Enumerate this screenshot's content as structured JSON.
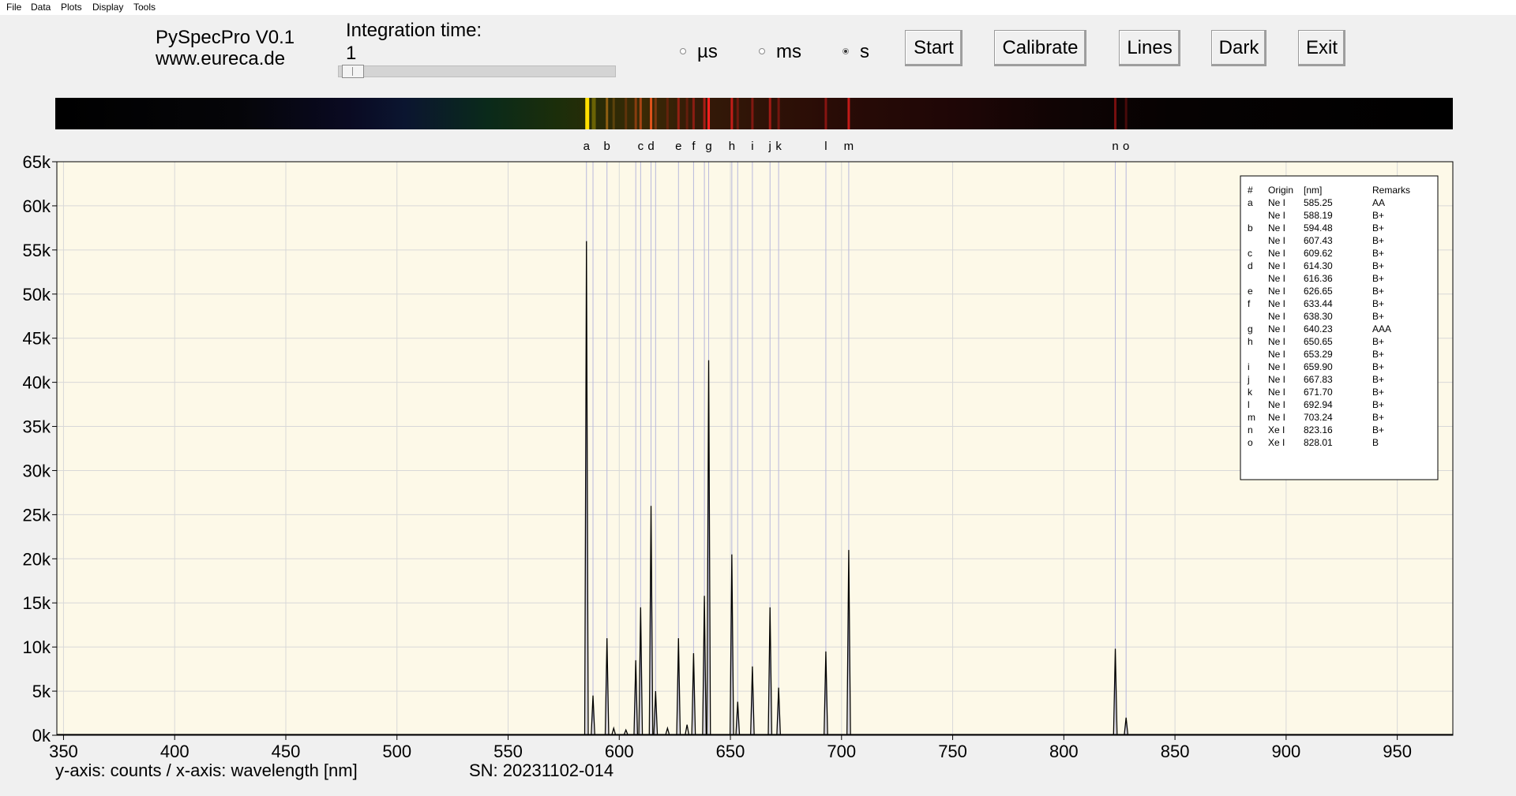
{
  "menu": [
    "File",
    "Data",
    "Plots",
    "Display",
    "Tools"
  ],
  "app": {
    "name": "PySpecPro V0.1",
    "website": "www.eureca.de"
  },
  "integration": {
    "label": "Integration time:",
    "value": "1",
    "slider_fraction": 0.01
  },
  "units": [
    {
      "label": "µs",
      "selected": false
    },
    {
      "label": "ms",
      "selected": false
    },
    {
      "label": "s",
      "selected": true
    }
  ],
  "buttons": {
    "start": "Start",
    "calibrate": "Calibrate",
    "lines": "Lines",
    "dark": "Dark",
    "exit": "Exit"
  },
  "footer": {
    "axes_caption": "y-axis: counts / x-axis: wavelength [nm]",
    "serial": "SN: 20231102-014"
  },
  "colors": {
    "plot_bg": "#fdf9e8",
    "grid": "#d8d8d8",
    "line_marker": "#b8b8dc",
    "trace": "#000000"
  },
  "chart_data": {
    "type": "line",
    "xlabel": "wavelength [nm]",
    "ylabel": "counts",
    "xlim": [
      347,
      975
    ],
    "ylim": [
      0,
      65000
    ],
    "xticks": [
      350,
      400,
      450,
      500,
      550,
      600,
      650,
      700,
      750,
      800,
      850,
      900,
      950
    ],
    "xtick_labels": [
      "350",
      "400",
      "450",
      "500",
      "550",
      "600",
      "650",
      "700",
      "750",
      "800",
      "850",
      "900",
      "950"
    ],
    "yticks": [
      0,
      5000,
      10000,
      15000,
      20000,
      25000,
      30000,
      35000,
      40000,
      45000,
      50000,
      55000,
      60000,
      65000
    ],
    "ytick_labels": [
      "0k",
      "5k",
      "10k",
      "15k",
      "20k",
      "25k",
      "30k",
      "35k",
      "40k",
      "45k",
      "50k",
      "55k",
      "60k",
      "65k"
    ],
    "grid": true,
    "peaks": [
      {
        "x": 585.25,
        "y": 56000
      },
      {
        "x": 588.19,
        "y": 4500
      },
      {
        "x": 594.48,
        "y": 11000
      },
      {
        "x": 597.5,
        "y": 800
      },
      {
        "x": 603.0,
        "y": 600
      },
      {
        "x": 607.43,
        "y": 8500
      },
      {
        "x": 609.62,
        "y": 14500
      },
      {
        "x": 614.3,
        "y": 26000
      },
      {
        "x": 616.36,
        "y": 5000
      },
      {
        "x": 621.7,
        "y": 800
      },
      {
        "x": 626.65,
        "y": 11000
      },
      {
        "x": 630.5,
        "y": 1200
      },
      {
        "x": 633.44,
        "y": 9300
      },
      {
        "x": 638.3,
        "y": 15800
      },
      {
        "x": 640.23,
        "y": 42500
      },
      {
        "x": 650.65,
        "y": 20500
      },
      {
        "x": 653.29,
        "y": 3800
      },
      {
        "x": 659.9,
        "y": 7800
      },
      {
        "x": 667.83,
        "y": 14500
      },
      {
        "x": 671.7,
        "y": 5400
      },
      {
        "x": 692.94,
        "y": 9500
      },
      {
        "x": 703.24,
        "y": 21000
      },
      {
        "x": 823.16,
        "y": 9800
      },
      {
        "x": 828.01,
        "y": 2000
      }
    ],
    "line_markers": [
      {
        "label": "a",
        "x": 585.25
      },
      {
        "label": "b",
        "x": 594.48
      },
      {
        "label": "c",
        "x": 609.62
      },
      {
        "label": "d",
        "x": 614.3
      },
      {
        "label": "e",
        "x": 626.65
      },
      {
        "label": "f",
        "x": 633.44
      },
      {
        "label": "g",
        "x": 640.23
      },
      {
        "label": "h",
        "x": 650.65
      },
      {
        "label": "i",
        "x": 659.9
      },
      {
        "label": "j",
        "x": 667.83
      },
      {
        "label": "k",
        "x": 671.7
      },
      {
        "label": "l",
        "x": 692.94
      },
      {
        "label": "m",
        "x": 703.24
      },
      {
        "label": "n",
        "x": 823.16
      },
      {
        "label": "o",
        "x": 828.01
      }
    ],
    "extra_marker_lines": [
      588.19,
      607.43,
      616.36,
      638.3,
      653.29
    ],
    "legend_position": "top-right",
    "legend": {
      "headers": [
        "#",
        "Origin",
        "[nm]",
        "Remarks"
      ],
      "rows": [
        [
          "a",
          "Ne I",
          "585.25",
          "AA"
        ],
        [
          "",
          "Ne I",
          "588.19",
          "B+"
        ],
        [
          "b",
          "Ne I",
          "594.48",
          "B+"
        ],
        [
          "",
          "Ne I",
          "607.43",
          "B+"
        ],
        [
          "c",
          "Ne I",
          "609.62",
          "B+"
        ],
        [
          "d",
          "Ne I",
          "614.30",
          "B+"
        ],
        [
          "",
          "Ne I",
          "616.36",
          "B+"
        ],
        [
          "e",
          "Ne I",
          "626.65",
          "B+"
        ],
        [
          "f",
          "Ne I",
          "633.44",
          "B+"
        ],
        [
          "",
          "Ne I",
          "638.30",
          "B+"
        ],
        [
          "g",
          "Ne I",
          "640.23",
          "AAA"
        ],
        [
          "h",
          "Ne I",
          "650.65",
          "B+"
        ],
        [
          "",
          "Ne I",
          "653.29",
          "B+"
        ],
        [
          "i",
          "Ne I",
          "659.90",
          "B+"
        ],
        [
          "j",
          "Ne I",
          "667.83",
          "B+"
        ],
        [
          "k",
          "Ne I",
          "671.70",
          "B+"
        ],
        [
          "l",
          "Ne I",
          "692.94",
          "B+"
        ],
        [
          "m",
          "Ne I",
          "703.24",
          "B+"
        ],
        [
          "n",
          "Xe I",
          "823.16",
          "B+"
        ],
        [
          "o",
          "Xe I",
          "828.01",
          "B"
        ]
      ]
    }
  }
}
